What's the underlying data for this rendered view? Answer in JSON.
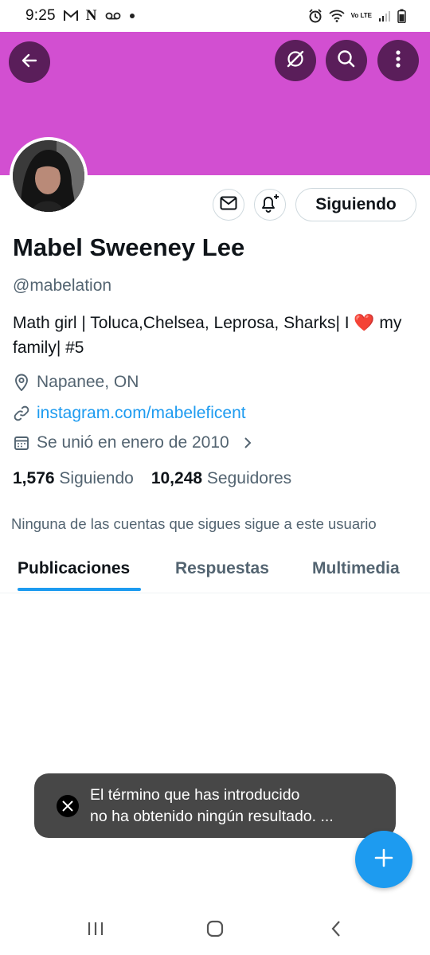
{
  "status_bar": {
    "time": "9:25",
    "left_icons": [
      "gmail-icon",
      "n-app-icon",
      "voicemail-icon",
      "dot-icon"
    ],
    "right_icons": [
      "alarm-icon",
      "wifi-icon",
      "volte-icon",
      "signal-icon",
      "battery-icon"
    ],
    "volte_label": "Vo LTE"
  },
  "header": {
    "banner_color": "#d24fd1",
    "button_color": "#5a1e5a",
    "buttons": [
      "back-icon",
      "grok-icon",
      "search-icon",
      "more-icon"
    ]
  },
  "profile": {
    "name": "Mabel Sweeney Lee",
    "handle": "@mabelation",
    "bio_text": "Math girl | Toluca,Chelsea, Leprosa, Sharks| I ",
    "bio_heart": "❤️",
    "bio_text_2": " my family| #5",
    "location": "Napanee, ON",
    "link": "instagram.com/mabeleficent",
    "joined": "Se unió en enero de 2010",
    "following_count": "1,576",
    "following_label": "Siguiendo",
    "followers_count": "10,248",
    "followers_label": "Seguidores",
    "mutual_note": "Ninguna de las cuentas que sigues sigue a este usuario"
  },
  "actions": {
    "follow_state_label": "Siguiendo"
  },
  "tabs": [
    {
      "label": "Publicaciones",
      "active": true
    },
    {
      "label": "Respuestas",
      "active": false
    },
    {
      "label": "Multimedia",
      "active": false
    }
  ],
  "toast": {
    "line1": "El término que has introducido",
    "line2": "no ha obtenido ningún resultado. ..."
  },
  "colors": {
    "accent": "#1d9bf0",
    "toast_bg": "#474747"
  }
}
